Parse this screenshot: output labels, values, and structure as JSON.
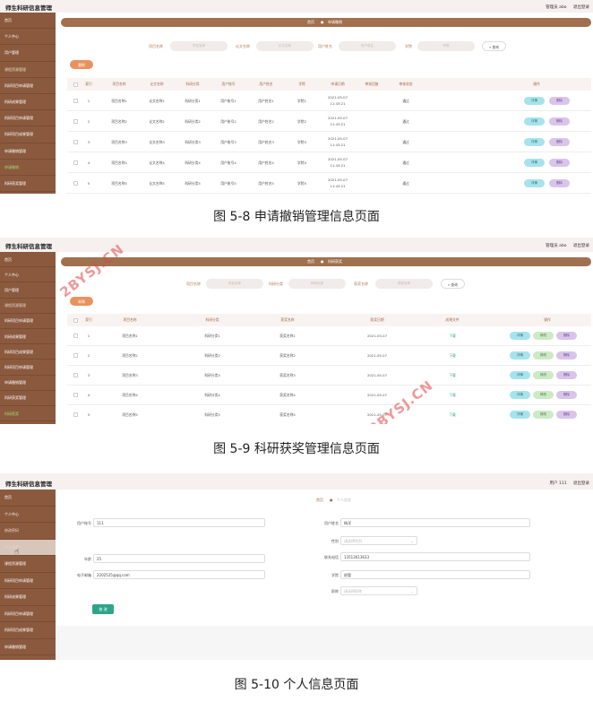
{
  "app_title": "师生科研信息管理",
  "shot1": {
    "top_right": {
      "user": "管理员 abo",
      "logout": "退出登录"
    },
    "sidebar": [
      "首页",
      "个人中心",
      "用户管理",
      "课程资源管理",
      "科研项目申请管理",
      "科研成果管理",
      "科研项目申请管理",
      "科研项目成果管理",
      "申请撤销管理",
      "申请撤销",
      "科研获奖管理"
    ],
    "breadcrumb": {
      "home": "首页",
      "current": "申请撤销"
    },
    "filters": [
      {
        "label": "项目名称",
        "placeholder": "项目名称"
      },
      {
        "label": "论文名称",
        "placeholder": "论文名称"
      },
      {
        "label": "用户姓名",
        "placeholder": "用户姓名"
      },
      {
        "label": "学院",
        "placeholder": "学院"
      }
    ],
    "search_label": "查询",
    "delete_label": "删除",
    "headers": [
      "索引",
      "项目名称",
      "论文名称",
      "科研分类",
      "用户账号",
      "用户姓名",
      "学院",
      "申请日期",
      "审核回复",
      "审核状态",
      "操作"
    ],
    "rows": [
      {
        "idx": "1",
        "project": "项目名称1",
        "paper": "论文名称1",
        "cat": "科研分类1",
        "account": "用户账号1",
        "name": "用户姓名1",
        "college": "学院1",
        "date": "2021-05-07 11:43:21",
        "reply": "",
        "status": "通过"
      },
      {
        "idx": "2",
        "project": "项目名称2",
        "paper": "论文名称2",
        "cat": "科研分类2",
        "account": "用户账号2",
        "name": "用户姓名2",
        "college": "学院2",
        "date": "2021-05-07 11:43:21",
        "reply": "",
        "status": "通过"
      },
      {
        "idx": "3",
        "project": "项目名称3",
        "paper": "论文名称3",
        "cat": "科研分类3",
        "account": "用户账号3",
        "name": "用户姓名3",
        "college": "学院3",
        "date": "2021-05-07 11:43:21",
        "reply": "",
        "status": "通过"
      },
      {
        "idx": "4",
        "project": "项目名称4",
        "paper": "论文名称4",
        "cat": "科研分类4",
        "account": "用户账号4",
        "name": "用户姓名4",
        "college": "学院4",
        "date": "2021-05-07 11:43:21",
        "reply": "",
        "status": "通过"
      },
      {
        "idx": "5",
        "project": "项目名称5",
        "paper": "论文名称5",
        "cat": "科研分类5",
        "account": "用户账号5",
        "name": "用户姓名5",
        "college": "学院5",
        "date": "2021-05-07 11:43:21",
        "reply": "",
        "status": "通过"
      }
    ],
    "btn_detail": "详情",
    "btn_delete": "删除",
    "caption": "图 5-8 申请撤销管理信息页面"
  },
  "shot2": {
    "top_right": {
      "user": "管理员 abo",
      "logout": "退出登录"
    },
    "sidebar": [
      "首页",
      "个人中心",
      "用户管理",
      "课程资源管理",
      "科研项目申请管理",
      "科研成果管理",
      "科研项目成果管理",
      "科研项目申请管理",
      "申请撤销管理",
      "科研获奖管理",
      "科研获奖"
    ],
    "breadcrumb": {
      "home": "首页",
      "current": "科研获奖"
    },
    "filters": [
      {
        "label": "项目名称",
        "placeholder": "项目名称"
      },
      {
        "label": "科研分类",
        "placeholder": "科研分类"
      },
      {
        "label": "获奖名称",
        "placeholder": "获奖名称"
      }
    ],
    "search_label": "查询",
    "add_label": "新增",
    "headers": [
      "索引",
      "项目名称",
      "科研分类",
      "获奖名称",
      "获奖日期",
      "成果文件",
      "操作"
    ],
    "rows": [
      {
        "idx": "1",
        "project": "项目名称1",
        "cat": "科研分类1",
        "award": "获奖名称1",
        "date": "2021-05-07",
        "file": "下载"
      },
      {
        "idx": "2",
        "project": "项目名称2",
        "cat": "科研分类2",
        "award": "获奖名称2",
        "date": "2021-05-07",
        "file": "下载"
      },
      {
        "idx": "3",
        "project": "项目名称3",
        "cat": "科研分类3",
        "award": "获奖名称3",
        "date": "2021-05-07",
        "file": "下载"
      },
      {
        "idx": "4",
        "project": "项目名称4",
        "cat": "科研分类4",
        "award": "获奖名称4",
        "date": "2021-05-07",
        "file": "下载"
      },
      {
        "idx": "5",
        "project": "项目名称5",
        "cat": "科研分类5",
        "award": "获奖名称5",
        "date": "2021-05-07",
        "file": "下载"
      }
    ],
    "btn_detail": "详情",
    "btn_edit": "修改",
    "btn_delete": "删除",
    "watermark": "2BYSJ.CN",
    "caption": "图 5-9 科研获奖管理信息页面"
  },
  "shot3": {
    "top_right": {
      "user": "用户 111",
      "logout": "退出登录"
    },
    "sidebar": [
      "首页",
      "个人中心",
      "修改密码",
      "个人信息",
      "课程资源管理",
      "科研项目申请管理",
      "科研成果管理",
      "科研项目申请管理",
      "科研项目成果管理",
      "申请撤销管理"
    ],
    "breadcrumb": {
      "home": "首页",
      "current": "个人信息"
    },
    "left_fields": [
      {
        "label": "用户账号",
        "value": "111"
      },
      {
        "label": "年龄",
        "value": "25"
      },
      {
        "label": "电子邮箱",
        "value": "2202525@qq.com"
      }
    ],
    "right_fields": [
      {
        "label": "用户姓名",
        "value": "杨洋",
        "select": false
      },
      {
        "label": "性别",
        "value": "请选择性别",
        "select": true
      },
      {
        "label": "联系电话",
        "value": "13513613633",
        "select": false
      },
      {
        "label": "学院",
        "value": "经管",
        "select": false
      },
      {
        "label": "职称",
        "value": "请选择职称",
        "select": true
      }
    ],
    "submit_label": "修 改",
    "caption": "图 5-10 个人信息页面"
  }
}
